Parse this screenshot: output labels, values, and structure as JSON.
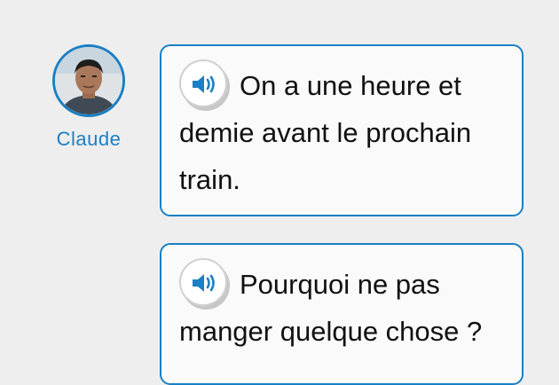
{
  "speaker": {
    "name": "Claude"
  },
  "messages": [
    {
      "text": "On a une heure et demie avant le prochain train.",
      "icon": "speaker-audio-icon"
    },
    {
      "text": "Pourquoi ne pas manger quelque chose ?",
      "icon": "speaker-audio-icon"
    }
  ],
  "colors": {
    "accent": "#1a7fc4",
    "background": "#eeeeee",
    "bubble": "#fafafa"
  }
}
